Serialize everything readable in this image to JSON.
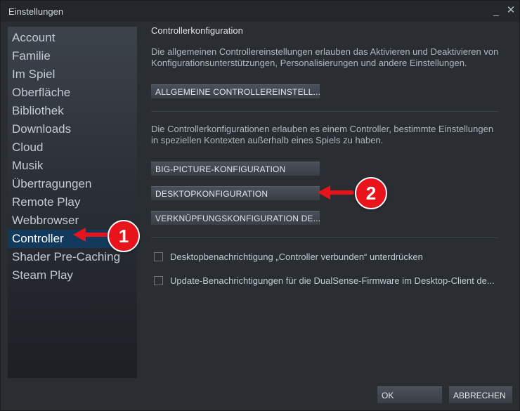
{
  "window": {
    "title": "Einstellungen",
    "minimize_glyph": "_",
    "close_glyph": "✕"
  },
  "sidebar": {
    "items": [
      {
        "label": "Account"
      },
      {
        "label": "Familie"
      },
      {
        "label": "Im Spiel"
      },
      {
        "label": "Oberfläche"
      },
      {
        "label": "Bibliothek"
      },
      {
        "label": "Downloads"
      },
      {
        "label": "Cloud"
      },
      {
        "label": "Musik"
      },
      {
        "label": "Übertragungen"
      },
      {
        "label": "Remote Play"
      },
      {
        "label": "Webbrowser"
      },
      {
        "label": "Controller",
        "active": true
      },
      {
        "label": "Shader Pre-Caching"
      },
      {
        "label": "Steam Play"
      }
    ]
  },
  "content": {
    "section_title": "Controllerkonfiguration",
    "desc1": "Die allgemeinen Controllereinstellungen erlauben das Aktivieren und Deaktivieren von Konfigurationsunterstützungen, Personalisierungen und andere Einstellungen.",
    "general_button": "ALLGEMEINE CONTROLLEREINSTELL...",
    "desc2": "Die Controllerkonfigurationen erlauben es einem Controller, bestimmte Einstellungen in speziellen Kontexten außerhalb eines Spiels zu haben.",
    "big_picture_button": "BIG-PICTURE-KONFIGURATION",
    "desktop_button": "DESKTOPKONFIGURATION",
    "shortcut_button": "VERKNÜPFUNGSKONFIGURATION DE...",
    "checkbox1": {
      "label": "Desktopbenachrichtigung „Controller verbunden“ unterdrücken",
      "checked": false
    },
    "checkbox2": {
      "label": "Update-Benachrichtigungen für die DualSense-Firmware im Desktop-Client de...",
      "checked": false
    }
  },
  "footer": {
    "ok": "OK",
    "cancel": "ABBRECHEN"
  },
  "annotations": {
    "badge1": "1",
    "badge2": "2",
    "color": "#e8131b"
  }
}
